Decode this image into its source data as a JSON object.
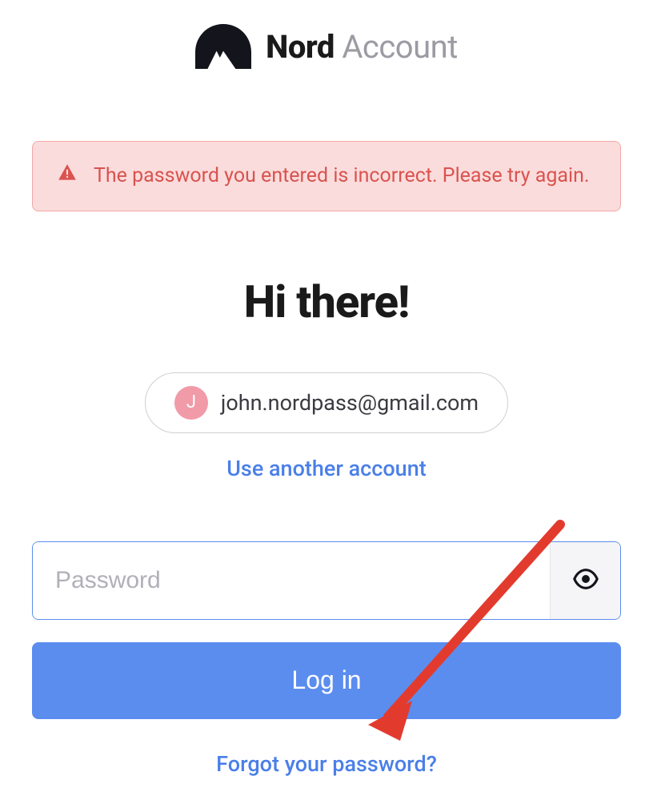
{
  "header": {
    "brand_bold": "Nord",
    "brand_light": "Account"
  },
  "error": {
    "message": "The password you entered is incorrect. Please try again."
  },
  "greeting": "Hi there!",
  "account": {
    "avatar_initial": "J",
    "email": "john.nordpass@gmail.com",
    "use_another_label": "Use another account"
  },
  "password": {
    "placeholder": "Password",
    "value": ""
  },
  "actions": {
    "login_label": "Log in",
    "forgot_label": "Forgot your password?"
  }
}
